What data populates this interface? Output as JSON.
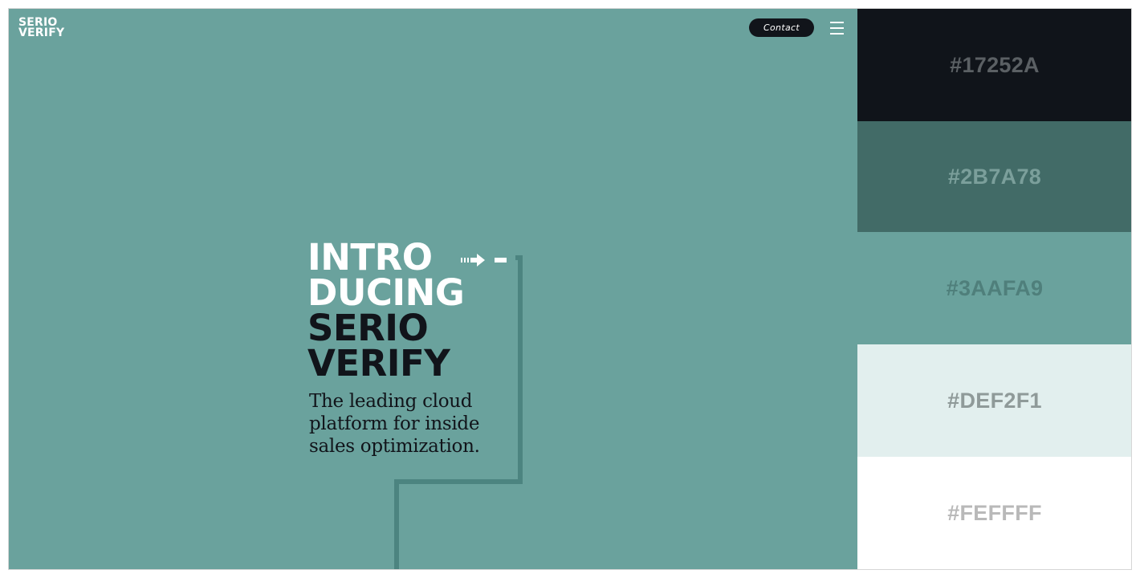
{
  "brand": {
    "logo_line1": "SERIO",
    "logo_line2": "VERIFY"
  },
  "header": {
    "contact_label": "Contact",
    "menu_icon": "hamburger-menu-icon"
  },
  "hero": {
    "background": "#6aa29d",
    "headline": [
      "INTRO",
      "DUCING",
      "SERIO",
      "VERIFY"
    ],
    "tagline": [
      "The leading cloud",
      "platform for inside",
      "sales optimization."
    ],
    "arrow_icon": "right-arrow-icon"
  },
  "palette": [
    {
      "hex": "#17252A",
      "background": "#10141a",
      "text_color": "#5b6064"
    },
    {
      "hex": "#2B7A78",
      "background": "#426b67",
      "text_color": "#7b9f9b"
    },
    {
      "hex": "#3AAFA9",
      "background": "#6aa29d",
      "text_color": "#4f7f7b"
    },
    {
      "hex": "#DEF2F1",
      "background": "#e2efee",
      "text_color": "#8f9a99"
    },
    {
      "hex": "#FEFFFF",
      "background": "#ffffff",
      "text_color": "#b9b9b9"
    }
  ]
}
